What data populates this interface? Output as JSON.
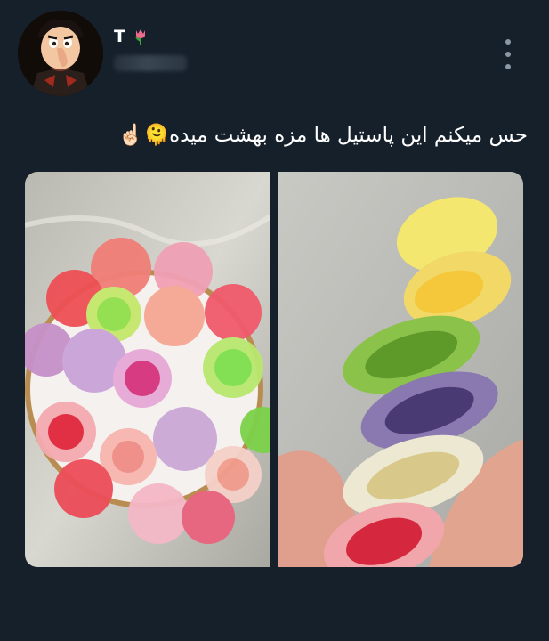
{
  "post": {
    "author": {
      "display_name": "T",
      "name_emoji": "tulip-icon",
      "handle": ""
    },
    "text": "حس میکنم این پاستیل ها مزه بهشت میده🫠☝🏻",
    "menu_icon": "more-vertical-icon",
    "media": [
      {
        "kind": "photo",
        "description_icon": "candy-bowl-photo"
      },
      {
        "kind": "photo",
        "description_icon": "candy-stack-photo"
      }
    ]
  },
  "colors": {
    "background": "#15202b",
    "text": "#ffffff",
    "muted": "#8b98a5"
  }
}
